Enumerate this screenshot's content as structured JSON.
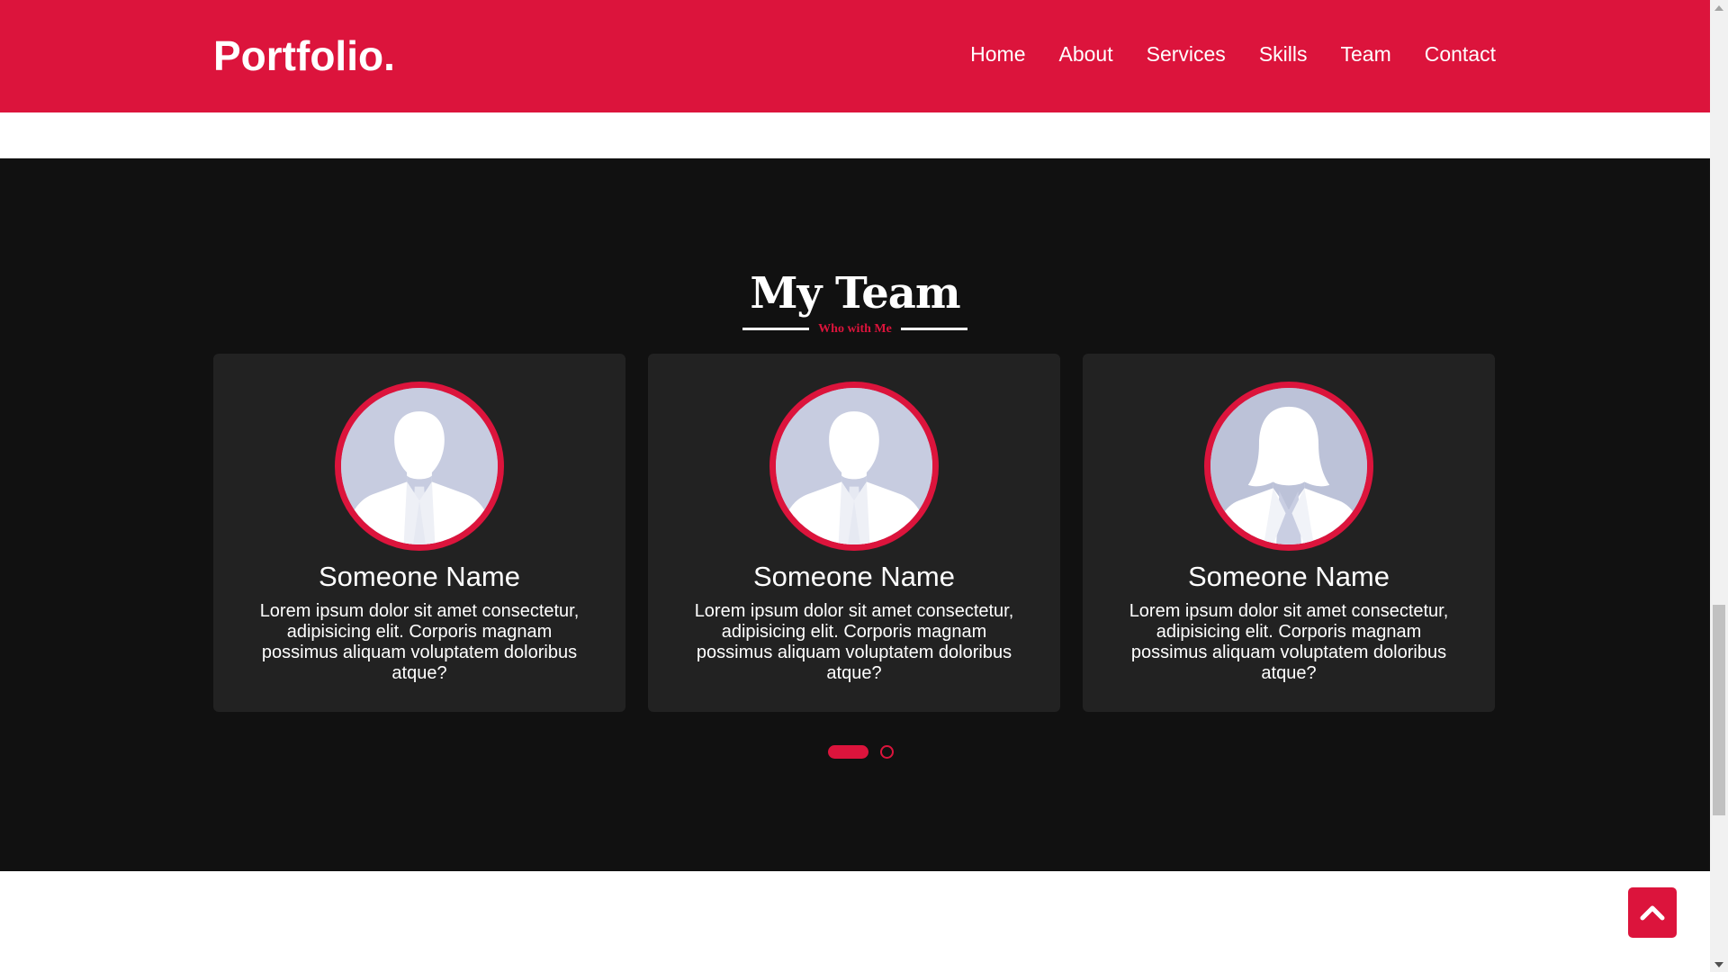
{
  "header": {
    "brand": "Portfolio.",
    "nav": [
      "Home",
      "About",
      "Services",
      "Skills",
      "Team",
      "Contact"
    ]
  },
  "team": {
    "title": "My Team",
    "subtitle": "Who with Me",
    "members": [
      {
        "name": "Someone Name",
        "description": "Lorem ipsum dolor sit amet consectetur, adipisicing elit. Corporis magnam possimus aliquam voluptatem doloribus atque?",
        "avatar": "male"
      },
      {
        "name": "Someone Name",
        "description": "Lorem ipsum dolor sit amet consectetur, adipisicing elit. Corporis magnam possimus aliquam voluptatem doloribus atque?",
        "avatar": "male"
      },
      {
        "name": "Someone Name",
        "description": "Lorem ipsum dolor sit amet consectetur, adipisicing elit. Corporis magnam possimus aliquam voluptatem doloribus atque?",
        "avatar": "female"
      }
    ],
    "carousel_pages": 2,
    "carousel_active": 1
  },
  "colors": {
    "accent": "#dc143c",
    "section_bg": "#111111",
    "card_bg": "#222222",
    "avatar_bg": "#c7cce0"
  },
  "icons": {
    "scroll_top": "chevron-up-icon",
    "avatar_male": "male-silhouette-icon",
    "avatar_female": "female-silhouette-icon"
  }
}
